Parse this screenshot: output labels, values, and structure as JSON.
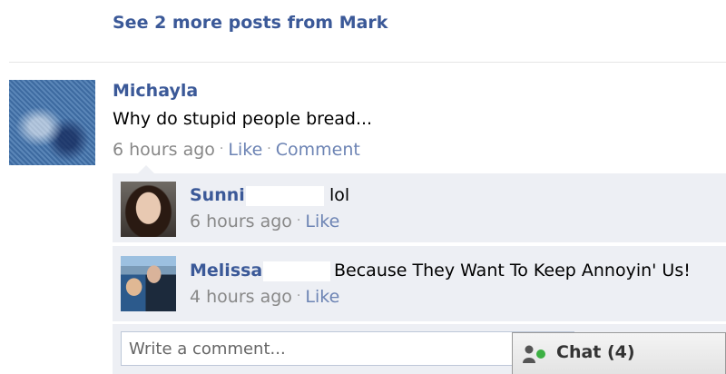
{
  "feed": {
    "see_more_link": "See 2 more posts from Mark"
  },
  "post": {
    "author": "Michayla",
    "text": "Why do stupid people bread...",
    "time": "6 hours ago",
    "like_label": "Like",
    "comment_label": "Comment"
  },
  "comments": [
    {
      "author": "Sunni",
      "text": "lol",
      "time": "6 hours ago",
      "like_label": "Like"
    },
    {
      "author": "Melissa",
      "text": "Because They Want To Keep Annoyin' Us!",
      "time": "4 hours ago",
      "like_label": "Like"
    }
  ],
  "write_comment": {
    "placeholder": "Write a comment..."
  },
  "chat": {
    "label": "Chat",
    "count": "(4)",
    "status_color": "#3cb043"
  },
  "colors": {
    "link": "#3b5998",
    "comment_bg": "#edeff4"
  },
  "separator": "·"
}
